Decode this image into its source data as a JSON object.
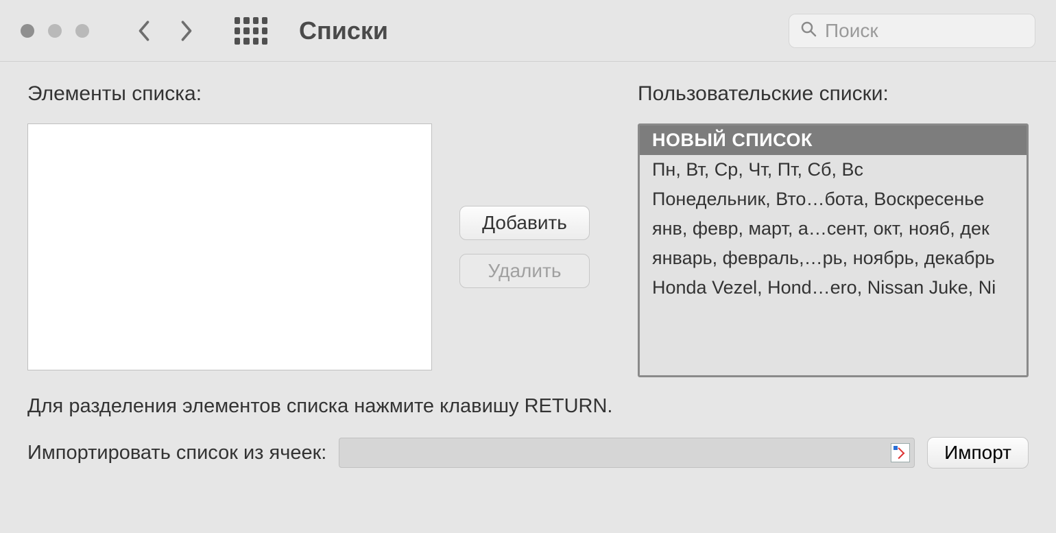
{
  "header": {
    "title": "Списки",
    "search_placeholder": "Поиск"
  },
  "labels": {
    "list_elements": "Элементы списка:",
    "custom_lists": "Пользовательские списки:",
    "hint": "Для разделения элементов списка нажмите клавишу RETURN.",
    "import_from_cells": "Импортировать список из ячеек:"
  },
  "buttons": {
    "add": "Добавить",
    "delete": "Удалить",
    "import": "Импорт"
  },
  "custom_lists": [
    {
      "text": "НОВЫЙ СПИСОК",
      "selected": true
    },
    {
      "text": "Пн, Вт, Ср, Чт, Пт, Сб, Вс",
      "selected": false
    },
    {
      "text": "Понедельник, Вто…бота, Воскресенье",
      "selected": false
    },
    {
      "text": "янв, февр, март, а…сент, окт, нояб, дек",
      "selected": false
    },
    {
      "text": "январь, февраль,…рь, ноябрь, декабрь",
      "selected": false
    },
    {
      "text": "Honda Vezel, Hond…ero, Nissan Juke, Ni",
      "selected": false
    }
  ],
  "import_field_value": ""
}
